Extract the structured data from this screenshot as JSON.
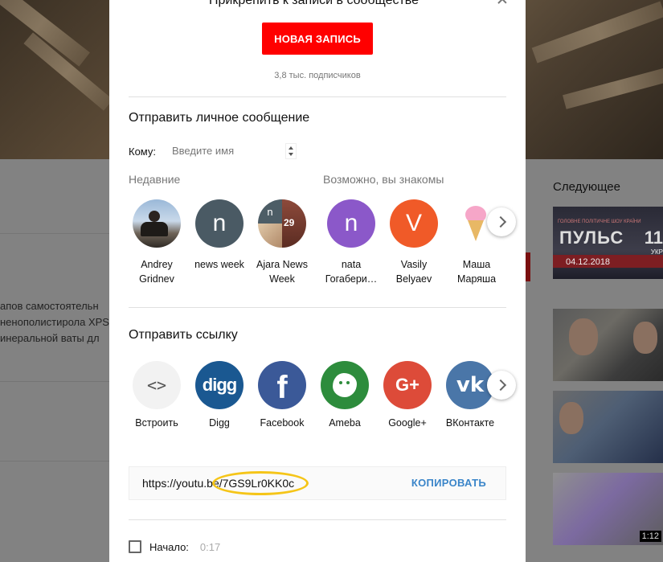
{
  "dialog": {
    "title": "Прикрепить к записи в сообществе",
    "new_post_label": "НОВАЯ ЗАПИСЬ",
    "subscribers": "3,8 тыс. подписчиков",
    "message_section": "Отправить личное сообщение",
    "to_label": "Кому:",
    "to_placeholder": "Введите имя",
    "recent_label": "Недавние",
    "maybe_label": "Возможно, вы знакомы",
    "contacts": [
      {
        "name": "Andrey Gridnev",
        "initial": "",
        "avatar": "photo"
      },
      {
        "name": "news week",
        "initial": "n",
        "avatar": "grey"
      },
      {
        "name": "Ajara News Week",
        "initial": "n",
        "avatar": "collage",
        "badge": "29"
      },
      {
        "name": "nata Гогабери…",
        "initial": "n",
        "avatar": "purple"
      },
      {
        "name": "Vasily Belyaev",
        "initial": "V",
        "avatar": "orange"
      },
      {
        "name": "Маша Маряша",
        "initial": "",
        "avatar": "icecream"
      }
    ],
    "link_section": "Отправить ссылку",
    "share_targets": [
      {
        "name": "Встроить",
        "icon": "code-icon",
        "glyph": "<>"
      },
      {
        "name": "Digg",
        "icon": "digg-icon",
        "glyph": "digg"
      },
      {
        "name": "Facebook",
        "icon": "facebook-icon",
        "glyph": "f"
      },
      {
        "name": "Ameba",
        "icon": "ameba-icon",
        "glyph": ""
      },
      {
        "name": "Google+",
        "icon": "google-plus-icon",
        "glyph": "G+"
      },
      {
        "name": "ВКонтакте",
        "icon": "vk-icon",
        "glyph": "vk"
      }
    ],
    "share_url": "https://youtu.be/7GS9Lr0KK0c",
    "copy_label": "КОПИРОВАТЬ",
    "start_label": "Начало:",
    "start_time": "0:17"
  },
  "background": {
    "next_title": "Следующее",
    "desc_lines": [
      "апов самостоятельн",
      "ненополистирола XPS",
      "инеральной ваты дл"
    ],
    "thumb1_brand_top": "ГОЛОВНЕ ПОЛІТИЧНЕ ШОУ КРАЇНИ",
    "thumb1_brand": "ПУЛЬС",
    "thumb1_num": "11",
    "thumb1_ukr": "УКР",
    "thumb1_date": "04.12.2018",
    "thumb4_duration": "1:12"
  },
  "colors": {
    "accent_red": "#ff0000",
    "copy_blue": "#3a85c9",
    "highlight": "#f5c518"
  }
}
